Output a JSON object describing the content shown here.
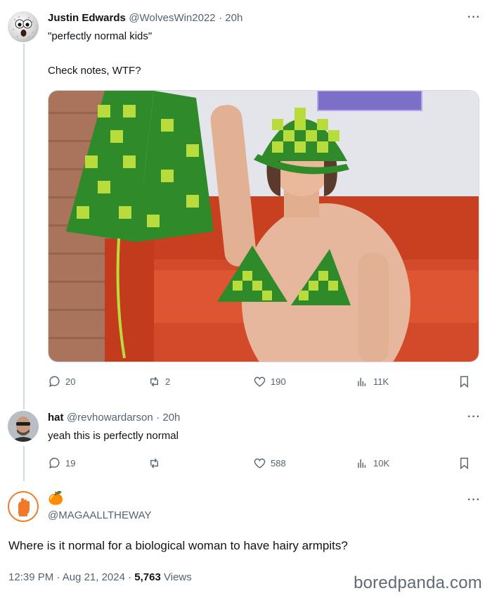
{
  "tweet1": {
    "name": "Justin Edwards",
    "handle": "@WolvesWin2022",
    "time": "· 20h",
    "line1": "\"perfectly normal kids\"",
    "line2": "Check notes, WTF?",
    "more": "···",
    "stats": {
      "replies": "20",
      "reposts": "2",
      "likes": "190",
      "views": "11K"
    }
  },
  "tweet2": {
    "name": "hat",
    "handle": "@revhowardarson",
    "time": "· 20h",
    "text": "yeah this is perfectly normal",
    "more": "···",
    "stats": {
      "replies": "19",
      "reposts": "",
      "likes": "588",
      "views": "10K"
    }
  },
  "tweet3": {
    "display_name_emoji": "🍊",
    "handle": "@MAGAALLTHEWAY",
    "text": "Where is it normal for a biological woman to have hairy armpits?",
    "more": "···",
    "timestamp": "12:39 PM · Aug 21, 2024 ·",
    "views_count": "5,763",
    "views_label": "Views"
  },
  "watermark": "boredpanda.com",
  "icons": {
    "reply": "reply-icon",
    "repost": "repost-icon",
    "like": "heart-icon",
    "views": "views-icon",
    "bookmark": "bookmark-icon"
  },
  "colors": {
    "muted": "#536471",
    "text": "#0f1419",
    "line": "#cfd9de",
    "accent": "#f07a2a"
  }
}
